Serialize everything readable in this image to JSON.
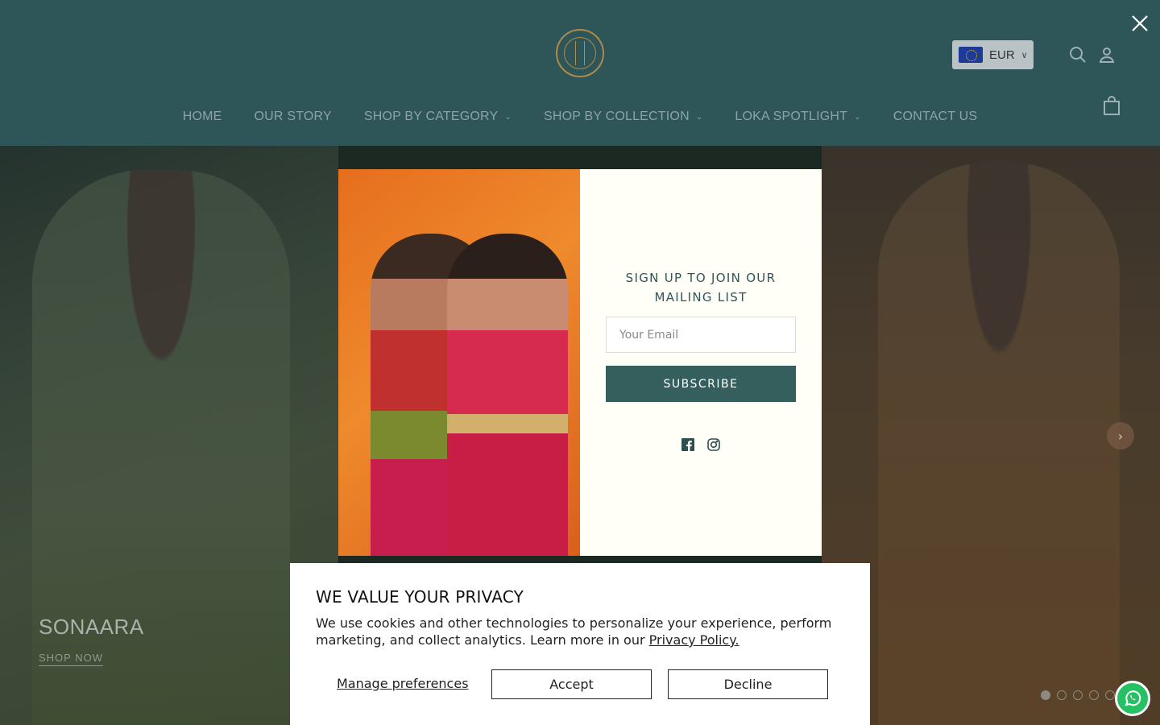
{
  "header": {
    "currency": {
      "code": "EUR"
    },
    "nav": [
      {
        "label": "HOME",
        "has_dropdown": false
      },
      {
        "label": "OUR STORY",
        "has_dropdown": false
      },
      {
        "label": "SHOP BY CATEGORY",
        "has_dropdown": true
      },
      {
        "label": "SHOP BY COLLECTION",
        "has_dropdown": true
      },
      {
        "label": "LOKA SPOTLIGHT",
        "has_dropdown": true
      },
      {
        "label": "CONTACT US",
        "has_dropdown": false
      }
    ],
    "icons": [
      "search-icon",
      "account-icon",
      "cart-icon"
    ]
  },
  "hero": {
    "slide_title": "SONAARA",
    "slide_cta": "SHOP NOW",
    "slide_count": 5,
    "active_slide": 1
  },
  "newsletter": {
    "title": "SIGN UP TO JOIN OUR MAILING LIST",
    "email_placeholder": "Your Email",
    "subscribe_label": "SUBSCRIBE",
    "social": [
      "facebook-icon",
      "instagram-icon"
    ]
  },
  "privacy": {
    "title": "WE VALUE YOUR PRIVACY",
    "text": "We use cookies and other technologies to personalize your experience, perform marketing, and collect analytics. Learn more in our",
    "link": "Privacy Policy.",
    "manage_label": "Manage preferences",
    "accept_label": "Accept",
    "decline_label": "Decline"
  },
  "colors": {
    "header_bg": "#2e5659",
    "accent": "#355f5d",
    "modal_bg": "#fffff7",
    "whatsapp": "#26c165"
  }
}
